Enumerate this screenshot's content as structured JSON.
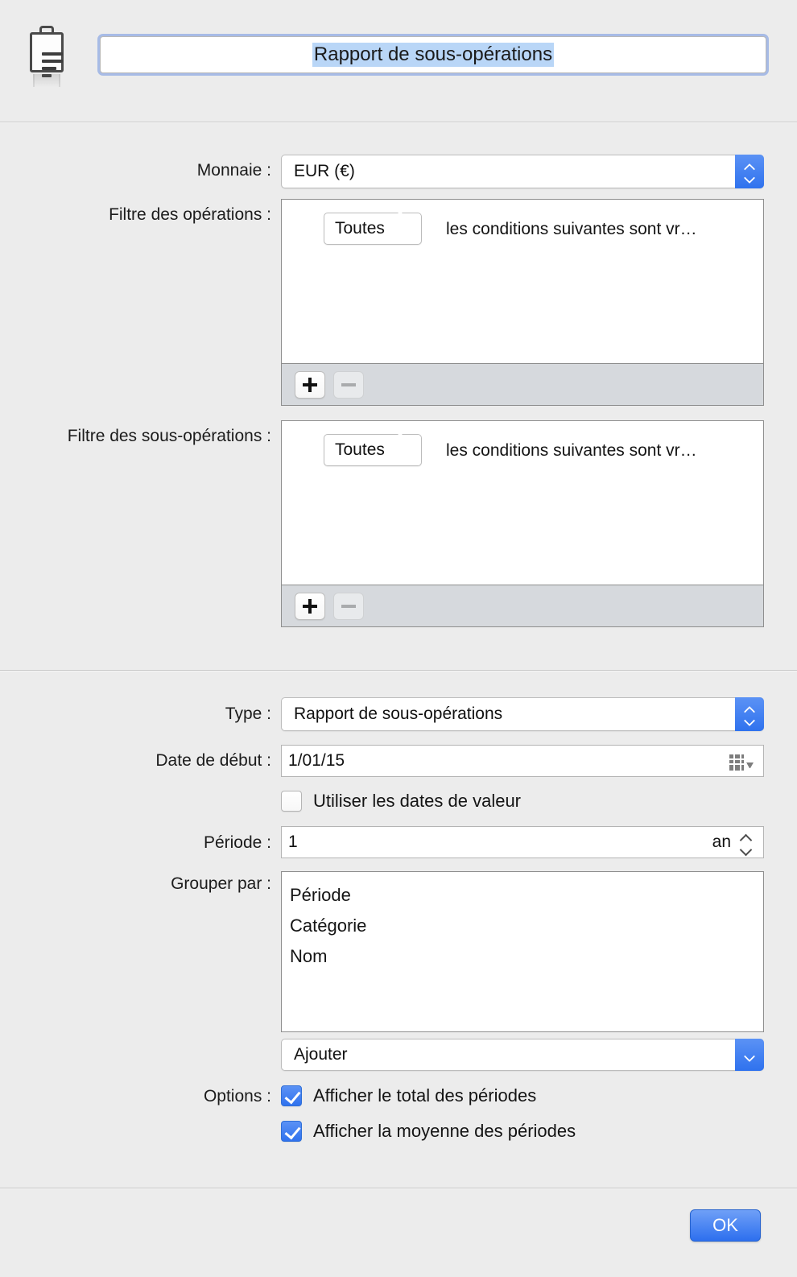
{
  "header": {
    "icon": "clipboard-icon",
    "title_value": "Rapport de sous-opérations"
  },
  "currency": {
    "label": "Monnaie :",
    "value": "EUR (€)"
  },
  "transaction_filter": {
    "label": "Filtre des opérations :",
    "match_value": "Toutes",
    "condition_text": "les conditions suivantes sont vr…",
    "add_label": "+",
    "remove_label": "−"
  },
  "subtransaction_filter": {
    "label": "Filtre des sous-opérations :",
    "match_value": "Toutes",
    "condition_text": "les conditions suivantes sont vr…",
    "add_label": "+",
    "remove_label": "−"
  },
  "type": {
    "label": "Type :",
    "value": "Rapport de sous-opérations"
  },
  "start_date": {
    "label": "Date de début :",
    "value": "1/01/15",
    "picker_icon": "calendar-icon"
  },
  "value_dates": {
    "label": "Utiliser les dates de valeur",
    "checked": false
  },
  "period": {
    "label": "Période :",
    "value": "1",
    "unit": "an"
  },
  "group_by": {
    "label": "Grouper par :",
    "items": [
      "Période",
      "Catégorie",
      "Nom"
    ],
    "add_menu_label": "Ajouter"
  },
  "options": {
    "label": "Options :",
    "items": [
      {
        "label": "Afficher le total des périodes",
        "checked": true
      },
      {
        "label": "Afficher la moyenne des périodes",
        "checked": true
      }
    ]
  },
  "footer": {
    "ok_label": "OK"
  },
  "colors": {
    "accent_blue": "#2f72ee",
    "window_bg": "#ececec",
    "selection_blue": "#b9d6f7",
    "focus_ring": "#a7bbe6",
    "toolbar_gray": "#d6d9dd"
  }
}
